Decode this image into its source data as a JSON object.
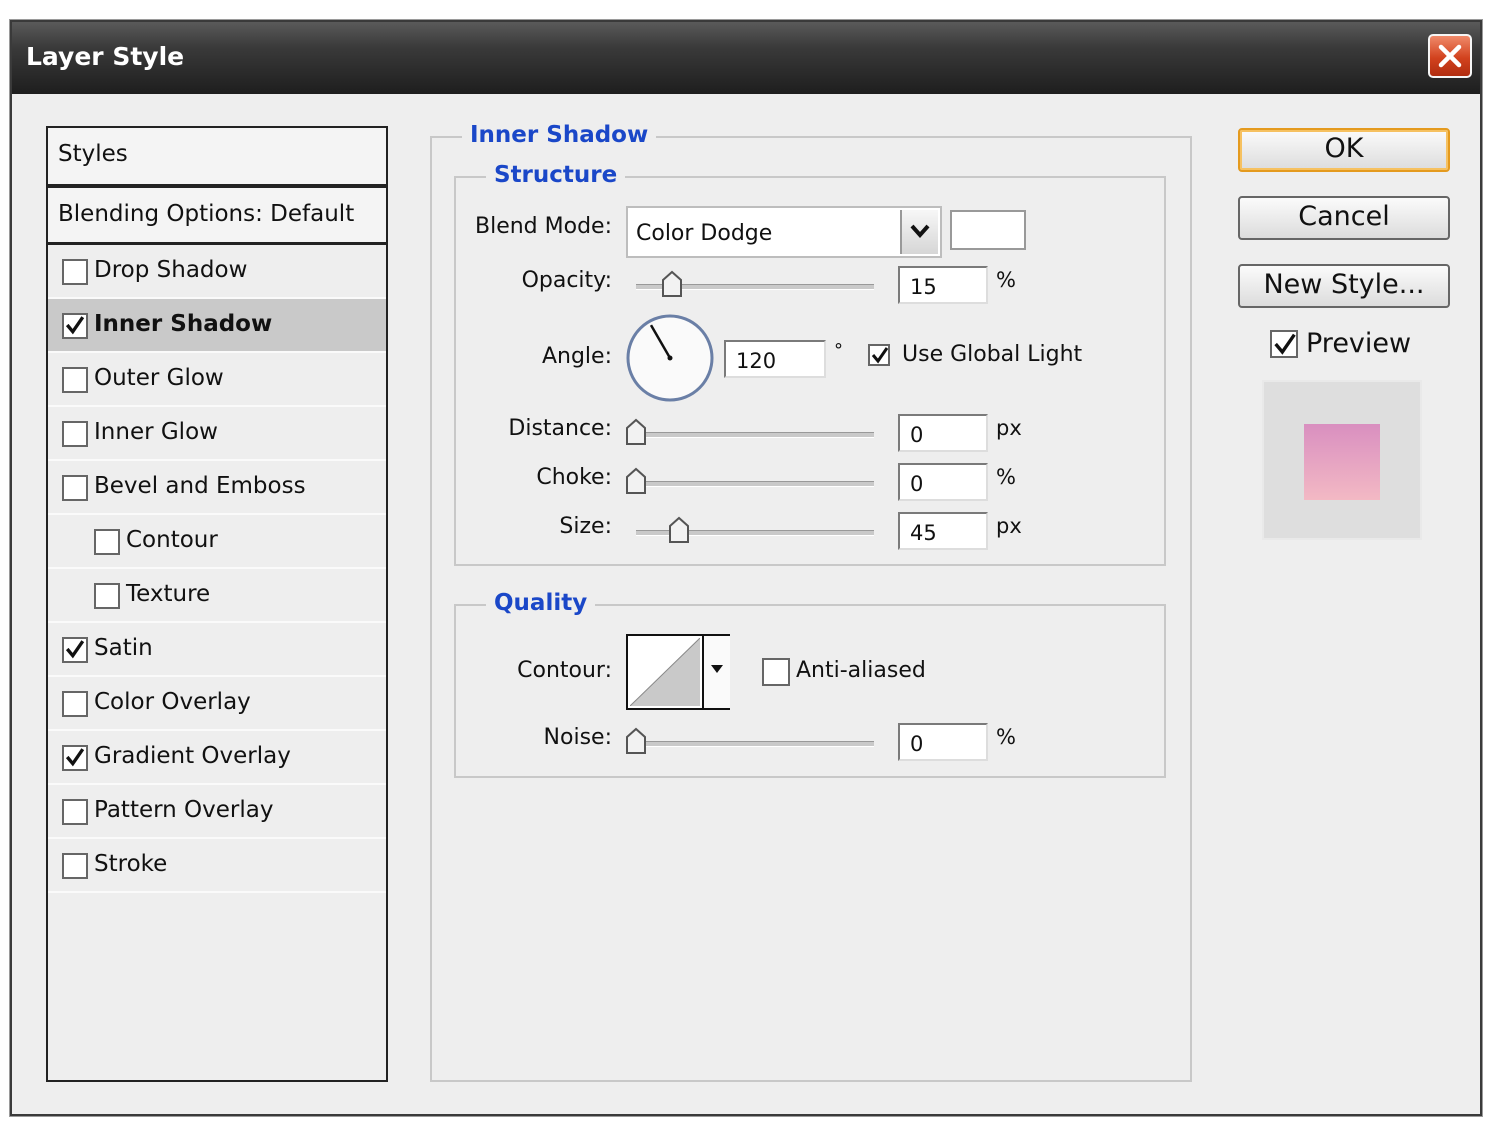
{
  "dialog": {
    "title": "Layer Style"
  },
  "styles_panel": {
    "header": "Styles",
    "blending_options": "Blending Options: Default",
    "items": [
      {
        "label": "Drop Shadow",
        "checked": false,
        "selected": false,
        "indent": false
      },
      {
        "label": "Inner Shadow",
        "checked": true,
        "selected": true,
        "indent": false
      },
      {
        "label": "Outer Glow",
        "checked": false,
        "selected": false,
        "indent": false
      },
      {
        "label": "Inner Glow",
        "checked": false,
        "selected": false,
        "indent": false
      },
      {
        "label": "Bevel and Emboss",
        "checked": false,
        "selected": false,
        "indent": false
      },
      {
        "label": "Contour",
        "checked": false,
        "selected": false,
        "indent": true
      },
      {
        "label": "Texture",
        "checked": false,
        "selected": false,
        "indent": true
      },
      {
        "label": "Satin",
        "checked": true,
        "selected": false,
        "indent": false
      },
      {
        "label": "Color Overlay",
        "checked": false,
        "selected": false,
        "indent": false
      },
      {
        "label": "Gradient Overlay",
        "checked": true,
        "selected": false,
        "indent": false
      },
      {
        "label": "Pattern Overlay",
        "checked": false,
        "selected": false,
        "indent": false
      },
      {
        "label": "Stroke",
        "checked": false,
        "selected": false,
        "indent": false
      }
    ]
  },
  "inner_shadow": {
    "title": "Inner Shadow",
    "structure": {
      "title": "Structure",
      "blend_mode_label": "Blend Mode:",
      "blend_mode_value": "Color Dodge",
      "shadow_color": "#ffffff",
      "opacity_label": "Opacity:",
      "opacity_value": "15",
      "opacity_unit": "%",
      "opacity_fraction": 0.15,
      "angle_label": "Angle:",
      "angle_value": "120",
      "angle_degrees": 120,
      "angle_unit": "°",
      "use_global_light_label": "Use Global Light",
      "use_global_light": true,
      "distance_label": "Distance:",
      "distance_value": "0",
      "distance_unit": "px",
      "distance_fraction": 0,
      "choke_label": "Choke:",
      "choke_value": "0",
      "choke_unit": "%",
      "choke_fraction": 0,
      "size_label": "Size:",
      "size_value": "45",
      "size_unit": "px",
      "size_fraction": 0.18
    },
    "quality": {
      "title": "Quality",
      "contour_label": "Contour:",
      "anti_aliased_label": "Anti-aliased",
      "anti_aliased": false,
      "noise_label": "Noise:",
      "noise_value": "0",
      "noise_unit": "%",
      "noise_fraction": 0
    }
  },
  "buttons": {
    "ok": "OK",
    "cancel": "Cancel",
    "new_style": "New Style...",
    "preview_label": "Preview",
    "preview_checked": true
  },
  "colors": {
    "accent_title": "#1a47c8",
    "ok_border": "#e49a1e",
    "preview_swatch_top": "#d98fc0",
    "preview_swatch_bottom": "#f3b9c4"
  }
}
